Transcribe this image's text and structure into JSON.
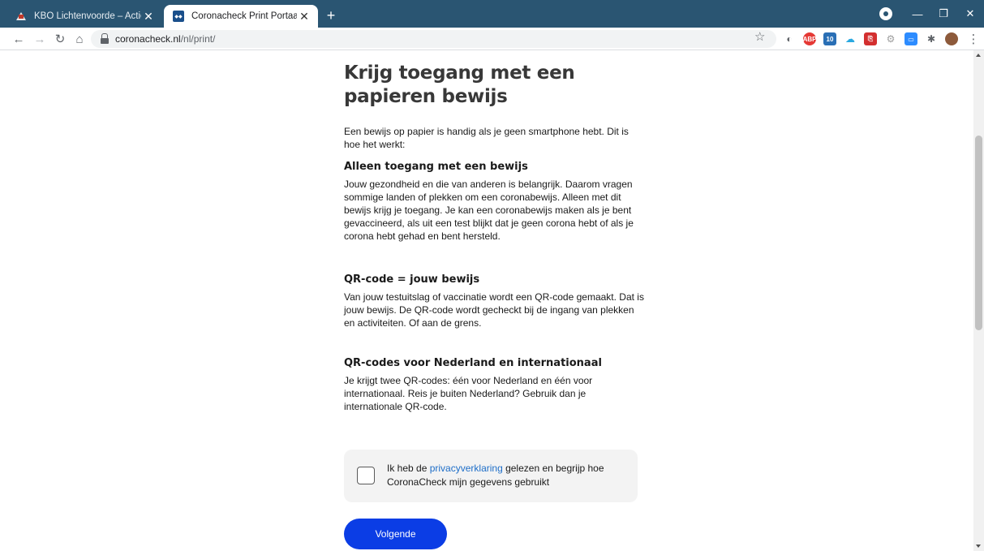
{
  "browser": {
    "tabs": [
      {
        "title": "KBO Lichtenvoorde – Actief voor",
        "active": false,
        "favicon": "kbo-house-icon"
      },
      {
        "title": "Coronacheck Print Portaal",
        "active": true,
        "favicon": "rijksoverheid-icon"
      }
    ],
    "url_host": "coronacheck.nl",
    "url_path": "/nl/print/",
    "colors": {
      "tabstrip": "#2a5572",
      "omnibox": "#f1f3f4"
    },
    "extensions": [
      {
        "name": "extension-circle-icon",
        "color": "#5f6368",
        "label": ""
      },
      {
        "name": "adblock-icon",
        "color": "#e53935",
        "label": "ABP"
      },
      {
        "name": "linkedin-badge-icon",
        "color": "#2a6fb5",
        "label": "10"
      },
      {
        "name": "cloud-icon",
        "color": "#29a8e0",
        "label": ""
      },
      {
        "name": "pdf-icon",
        "color": "#d32f2f",
        "label": ""
      },
      {
        "name": "gear-extension-icon",
        "color": "#9e9e9e",
        "label": ""
      },
      {
        "name": "zoom-icon",
        "color": "#2d8cff",
        "label": ""
      },
      {
        "name": "puzzle-icon",
        "color": "#5f6368",
        "label": ""
      },
      {
        "name": "avatar",
        "color": "#8d5a3b",
        "label": ""
      }
    ]
  },
  "page": {
    "title": "Krijg toegang met een papieren bewijs",
    "intro": "Een bewijs op papier is handig als je geen smartphone hebt. Dit is hoe het werkt:",
    "sections": [
      {
        "title": "Alleen toegang met een bewijs",
        "body": "Jouw gezondheid en die van anderen is belangrijk. Daarom vragen sommige landen of plekken om een coronabewijs. Alleen met dit bewijs krijg je toegang. Je kan een coronabewijs maken als je bent gevaccineerd, als uit een test blijkt dat je geen corona hebt of als je corona hebt gehad en bent hersteld."
      },
      {
        "title": "QR-code = jouw bewijs",
        "body": "Van jouw testuitslag of vaccinatie wordt een QR-code gemaakt. Dat is jouw bewijs. De QR-code wordt gecheckt bij de ingang van plekken en activiteiten. Of aan de grens."
      },
      {
        "title": "QR-codes voor Nederland en internationaal",
        "body": "Je krijgt twee QR-codes: één voor Nederland en één voor internationaal. Reis je buiten Nederland? Gebruik dan je internationale QR-code."
      }
    ],
    "consent": {
      "before": "Ik heb de ",
      "link": "privacyverklaring",
      "after": " gelezen en begrijp hoe CoronaCheck mijn gegevens gebruikt",
      "checked": false
    },
    "next_label": "Volgende",
    "colors": {
      "button": "#0b3de5",
      "link": "#1e6ec8",
      "consent_bg": "#f3f3f3"
    }
  }
}
